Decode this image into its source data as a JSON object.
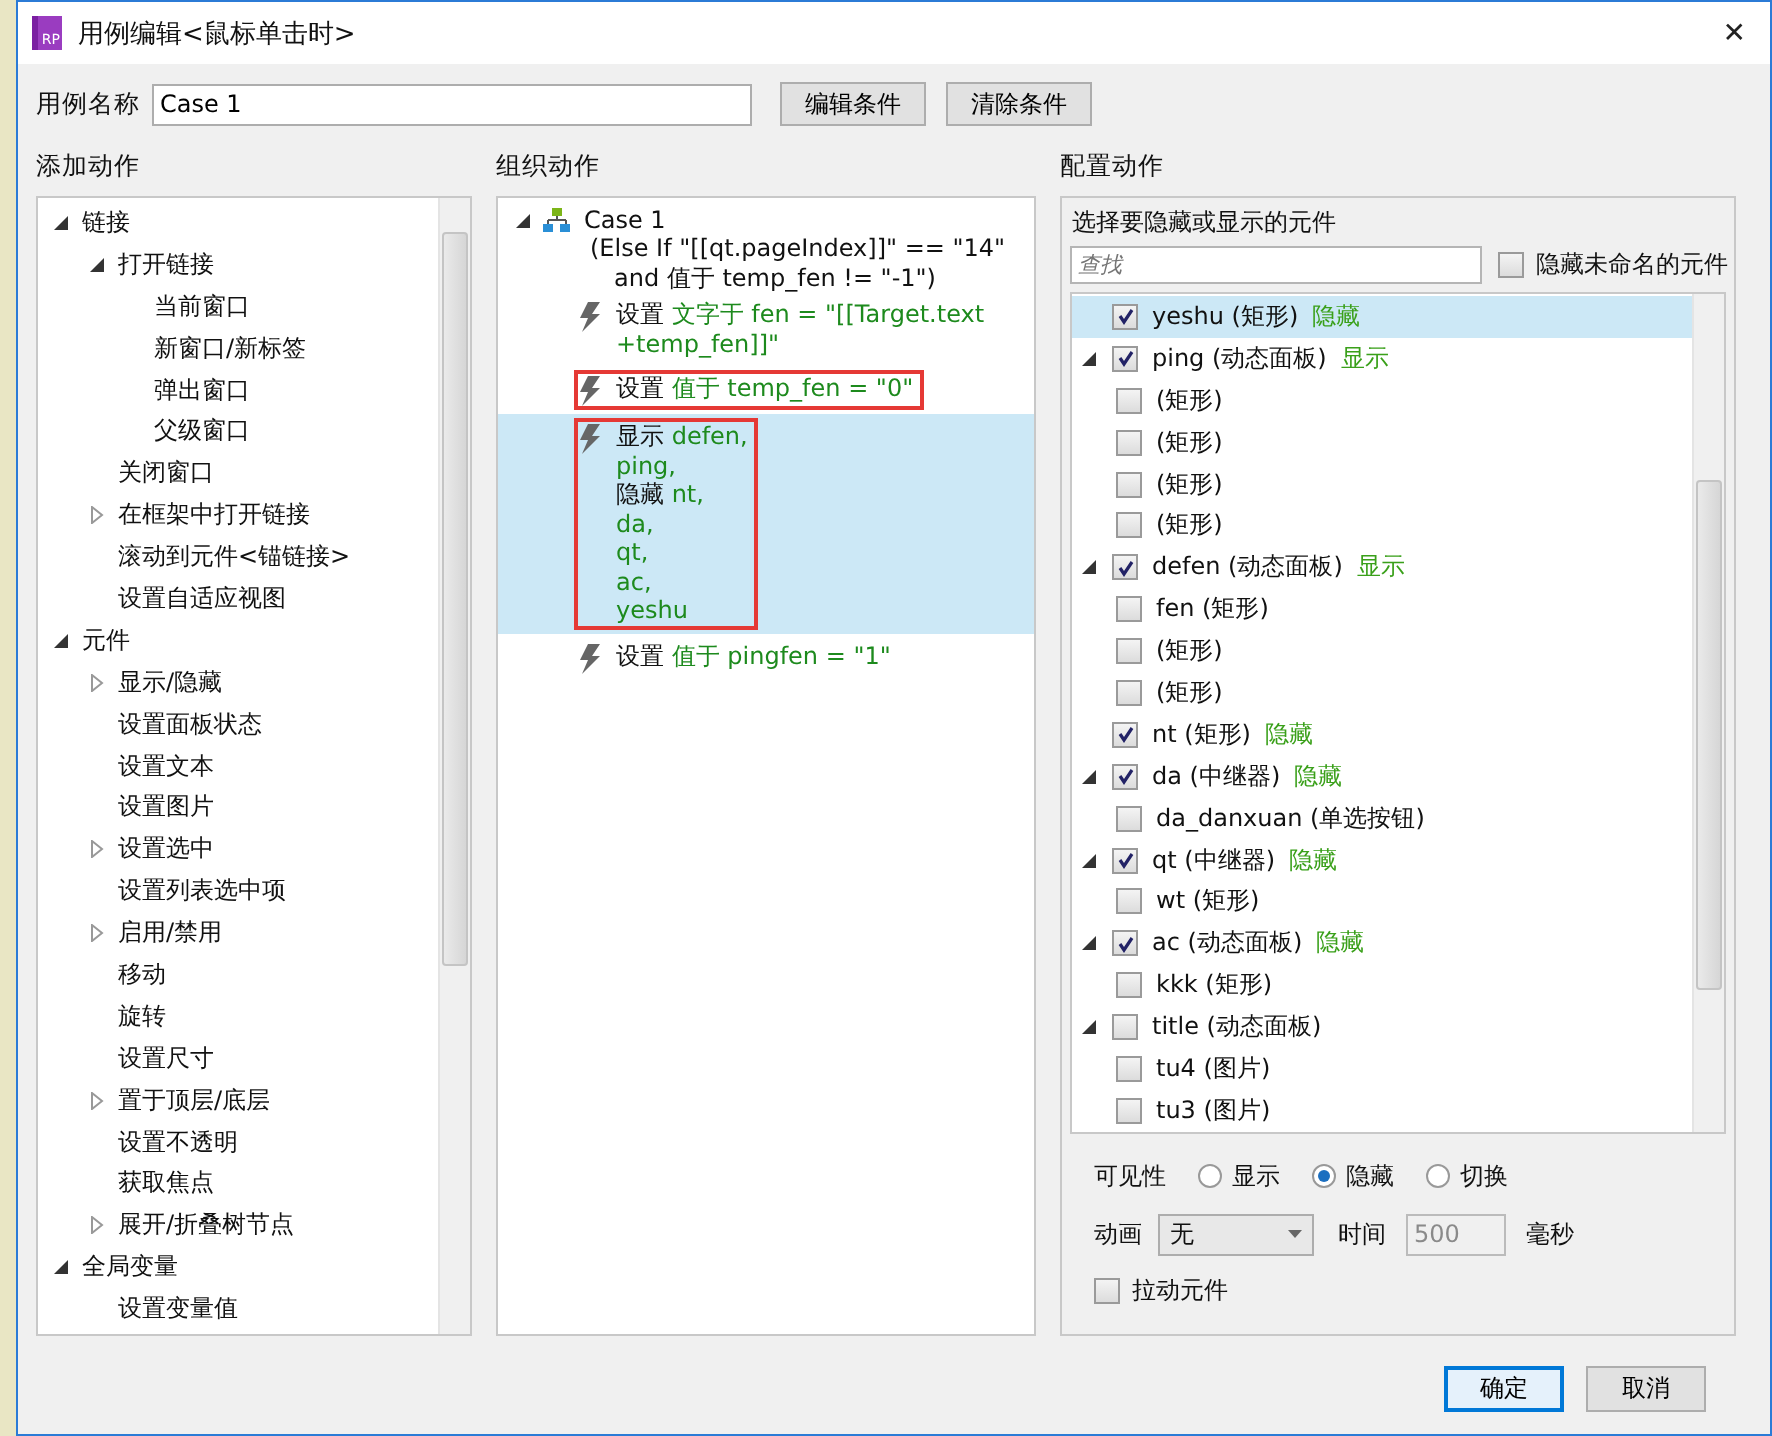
{
  "window": {
    "logo_text": "RP",
    "title": "用例编辑<鼠标单击时>",
    "close": "✕"
  },
  "case_name": {
    "label": "用例名称",
    "value": "Case 1",
    "buttons": [
      "编辑条件",
      "清除条件"
    ]
  },
  "add_actions": {
    "heading": "添加动作",
    "items": [
      {
        "label": "链接",
        "expanded": true,
        "children": [
          {
            "label": "打开链接",
            "expanded": true,
            "children": [
              {
                "label": "当前窗口"
              },
              {
                "label": "新窗口/新标签"
              },
              {
                "label": "弹出窗口"
              },
              {
                "label": "父级窗口"
              }
            ]
          },
          {
            "label": "关闭窗口"
          },
          {
            "label": "在框架中打开链接",
            "expanded": false
          },
          {
            "label": "滚动到元件<锚链接>"
          },
          {
            "label": "设置自适应视图"
          }
        ]
      },
      {
        "label": "元件",
        "expanded": true,
        "children": [
          {
            "label": "显示/隐藏",
            "expanded": false
          },
          {
            "label": "设置面板状态"
          },
          {
            "label": "设置文本"
          },
          {
            "label": "设置图片"
          },
          {
            "label": "设置选中",
            "expanded": false
          },
          {
            "label": "设置列表选中项"
          },
          {
            "label": "启用/禁用",
            "expanded": false
          },
          {
            "label": "移动"
          },
          {
            "label": "旋转"
          },
          {
            "label": "设置尺寸"
          },
          {
            "label": "置于顶层/底层",
            "expanded": false
          },
          {
            "label": "设置不透明"
          },
          {
            "label": "获取焦点"
          },
          {
            "label": "展开/折叠树节点",
            "expanded": false
          }
        ]
      },
      {
        "label": "全局变量",
        "expanded": true,
        "children": [
          {
            "label": "设置变量值"
          }
        ]
      }
    ]
  },
  "organize_actions": {
    "heading": "组织动作",
    "case": {
      "title": "Case 1",
      "expanded": true,
      "condition_lines": [
        "(Else If \"[[qt.pageIndex]]\" == \"14\"",
        "and 值于 temp_fen != \"-1\")"
      ]
    },
    "actions": [
      {
        "selected": false,
        "annotated": false,
        "lines": [
          {
            "verb": "设置",
            "text": "文字于 fen = \"[[Target.text"
          },
          {
            "text": "+temp_fen]]\""
          }
        ]
      },
      {
        "selected": false,
        "annotated": true,
        "lines": [
          {
            "verb": "设置",
            "text": "值于 temp_fen = \"0\""
          }
        ]
      },
      {
        "selected": true,
        "annotated": true,
        "lines": [
          {
            "verb": "显示",
            "text": "defen,"
          },
          {
            "text": "ping,"
          },
          {
            "verb": "隐藏",
            "text": "nt,"
          },
          {
            "text": "da,"
          },
          {
            "text": "qt,"
          },
          {
            "text": "ac,"
          },
          {
            "text": "yeshu"
          }
        ]
      },
      {
        "selected": false,
        "annotated": false,
        "lines": [
          {
            "verb": "设置",
            "text": "值于 pingfen = \"1\""
          }
        ]
      }
    ]
  },
  "configure_action": {
    "heading": "配置动作",
    "prompt": "选择要隐藏或显示的元件",
    "search": {
      "placeholder": "查找"
    },
    "hide_unnamed": {
      "label": "隐藏未命名的元件",
      "checked": false
    },
    "widgets": [
      {
        "name": "yeshu (矩形)",
        "state": "隐藏",
        "checked": true,
        "selected": true
      },
      {
        "name": "ping (动态面板)",
        "state": "显示",
        "checked": true,
        "selected": false,
        "expanded": true,
        "children": [
          {
            "name": "(矩形)",
            "checked": false,
            "selected": false
          },
          {
            "name": "(矩形)",
            "checked": false,
            "selected": false
          },
          {
            "name": "(矩形)",
            "checked": false,
            "selected": false
          },
          {
            "name": "(矩形)",
            "checked": false,
            "selected": false
          }
        ]
      },
      {
        "name": "defen (动态面板)",
        "state": "显示",
        "checked": true,
        "selected": false,
        "expanded": true,
        "children": [
          {
            "name": "fen (矩形)",
            "checked": false,
            "selected": false
          },
          {
            "name": "(矩形)",
            "checked": false,
            "selected": false
          },
          {
            "name": "(矩形)",
            "checked": false,
            "selected": false
          }
        ]
      },
      {
        "name": "nt (矩形)",
        "state": "隐藏",
        "checked": true,
        "selected": false
      },
      {
        "name": "da (中继器)",
        "state": "隐藏",
        "checked": true,
        "selected": false,
        "expanded": true,
        "children": [
          {
            "name": "da_danxuan (单选按钮)",
            "checked": false,
            "selected": false
          }
        ]
      },
      {
        "name": "qt (中继器)",
        "state": "隐藏",
        "checked": true,
        "selected": false,
        "expanded": true,
        "children": [
          {
            "name": "wt (矩形)",
            "checked": false,
            "selected": false
          }
        ]
      },
      {
        "name": "ac (动态面板)",
        "state": "隐藏",
        "checked": true,
        "selected": false,
        "expanded": true,
        "children": [
          {
            "name": "kkk (矩形)",
            "checked": false,
            "selected": false
          }
        ]
      },
      {
        "name": "title (动态面板)",
        "checked": false,
        "selected": false,
        "expanded": true,
        "children": [
          {
            "name": "tu4 (图片)",
            "checked": false,
            "selected": false
          },
          {
            "name": "tu3 (图片)",
            "checked": false,
            "selected": false
          }
        ]
      }
    ],
    "visibility": {
      "label": "可见性",
      "options": [
        {
          "label": "显示",
          "selected": false
        },
        {
          "label": "隐藏",
          "selected": true
        },
        {
          "label": "切换",
          "selected": false
        }
      ]
    },
    "animation": {
      "label": "动画",
      "value": "无",
      "time_label": "时间",
      "time_value": "500",
      "time_disabled": true,
      "unit": "毫秒"
    },
    "drag_widget": {
      "label": "拉动元件",
      "checked": false
    }
  },
  "footer": {
    "buttons": [
      {
        "label": "确定",
        "default": true
      },
      {
        "label": "取消",
        "default": false
      }
    ]
  }
}
